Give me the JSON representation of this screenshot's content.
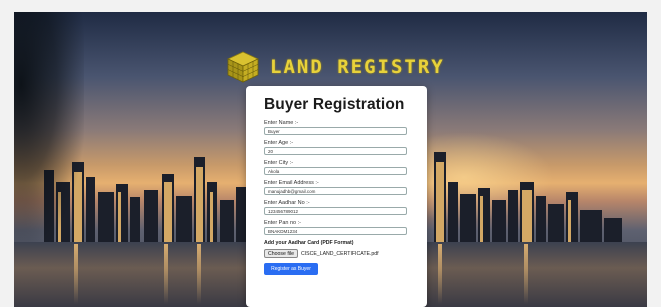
{
  "brand": {
    "title": "LAND REGISTRY"
  },
  "form": {
    "heading": "Buyer Registration",
    "fields": [
      {
        "label": "Enter Name :-",
        "value": "Buyer"
      },
      {
        "label": "Enter Age :-",
        "value": "20"
      },
      {
        "label": "Enter City :-",
        "value": "Akola"
      },
      {
        "label": "Enter Email Address :-",
        "value": "manujadhb@gmail.com"
      },
      {
        "label": "Enter Aadhar No :-",
        "value": "123456789012"
      },
      {
        "label": "Enter Pan no :-",
        "value": "BNAKDM1234"
      }
    ],
    "upload_label": "Add your Aadhar Card (PDF Format)",
    "choose_file_label": "Choose file",
    "file_name": "CISCE_LAND_CERTIFICATE.pdf",
    "submit_label": "Register as Buyer"
  },
  "colors": {
    "accent": "#2a6df2",
    "logo": "#e8d23a"
  },
  "icons": {
    "logo": "land-registry-cube-icon"
  }
}
